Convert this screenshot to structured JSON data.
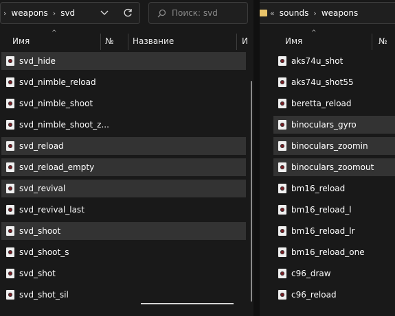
{
  "left": {
    "breadcrumb": [
      "weapons",
      "svd"
    ],
    "search_placeholder": "Поиск: svd",
    "columns": {
      "name": "Имя",
      "number": "№",
      "title": "Название",
      "partial": "И"
    },
    "files": [
      {
        "name": "svd_hide",
        "selected": true
      },
      {
        "name": "svd_nimble_reload",
        "selected": false
      },
      {
        "name": "svd_nimble_shoot",
        "selected": false
      },
      {
        "name": "svd_nimble_shoot_z...",
        "selected": false
      },
      {
        "name": "svd_reload",
        "selected": true
      },
      {
        "name": "svd_reload_empty",
        "selected": true
      },
      {
        "name": "svd_revival",
        "selected": true
      },
      {
        "name": "svd_revival_last",
        "selected": false
      },
      {
        "name": "svd_shoot",
        "selected": true
      },
      {
        "name": "svd_shoot_s",
        "selected": false
      },
      {
        "name": "svd_shot",
        "selected": false
      },
      {
        "name": "svd_shot_sil",
        "selected": false
      }
    ]
  },
  "right": {
    "breadcrumb": [
      "sounds",
      "weapons"
    ],
    "columns": {
      "name": "Имя",
      "number": "№"
    },
    "files": [
      {
        "name": "aks74u_shot",
        "selected": false
      },
      {
        "name": "aks74u_shot55",
        "selected": false
      },
      {
        "name": "beretta_reload",
        "selected": false
      },
      {
        "name": "binoculars_gyro",
        "selected": true
      },
      {
        "name": "binoculars_zoomin",
        "selected": true
      },
      {
        "name": "binoculars_zoomout",
        "selected": true
      },
      {
        "name": "bm16_reload",
        "selected": false
      },
      {
        "name": "bm16_reload_l",
        "selected": false
      },
      {
        "name": "bm16_reload_lr",
        "selected": false
      },
      {
        "name": "bm16_reload_one",
        "selected": false
      },
      {
        "name": "c96_draw",
        "selected": false
      },
      {
        "name": "c96_reload",
        "selected": false
      }
    ]
  },
  "colors": {
    "background": "#191919",
    "selected_row": "#333333",
    "text": "#ffffff"
  },
  "icons": {
    "dropdown": "chevron-down-icon",
    "refresh": "refresh-icon",
    "search": "search-icon",
    "file": "audio-file-icon",
    "folder": "folder-icon",
    "breadcrumb_separator": "chevron-right-icon",
    "history": "double-chevron-left-icon"
  }
}
